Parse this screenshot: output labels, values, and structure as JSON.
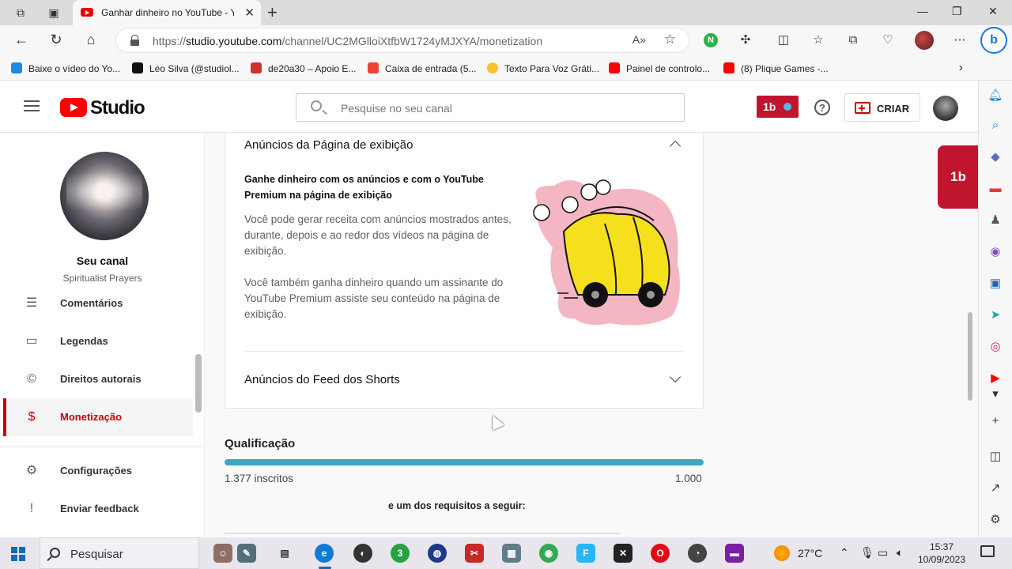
{
  "browser": {
    "tab_title": "Ganhar dinheiro no YouTube - Yo",
    "url_prefix": "https://",
    "url_host": "studio.youtube.com",
    "url_path": "/channel/UC2MGlloiXtfbW1724yMJXYA/monetization",
    "bookmarks": [
      {
        "label": "Baixe o vídeo do Yo...",
        "icon": "download-icon",
        "color": "#1e88e5"
      },
      {
        "label": "Léo Silva (@studiol...",
        "icon": "tiktok-icon",
        "color": "#111111"
      },
      {
        "label": "de20a30 – Apoio E...",
        "icon": "bus-icon",
        "color": "#d32f2f"
      },
      {
        "label": "Caixa de entrada (5...",
        "icon": "gmail-icon",
        "color": "#ea4335"
      },
      {
        "label": "Texto Para Voz Gráti...",
        "icon": "emoji-icon",
        "color": "#fbc02d"
      },
      {
        "label": "Painel de controlo...",
        "icon": "youtube-icon",
        "color": "#ff0000"
      },
      {
        "label": "(8) Plique Games -...",
        "icon": "youtube-icon",
        "color": "#ff0000"
      }
    ]
  },
  "studio": {
    "logo_text": "Studio",
    "search_placeholder": "Pesquise no seu canal",
    "tubebuddy_label": "1b",
    "create_label": "CRIAR"
  },
  "sidebar": {
    "channel_name": "Seu canal",
    "channel_sub": "Spiritualist Prayers",
    "items": [
      {
        "label": "Comentários",
        "icon": "comment-icon",
        "glyph": "☰"
      },
      {
        "label": "Legendas",
        "icon": "subtitles-icon",
        "glyph": "▭"
      },
      {
        "label": "Direitos autorais",
        "icon": "copyright-icon",
        "glyph": "©"
      },
      {
        "label": "Monetização",
        "icon": "dollar-icon",
        "glyph": "$"
      },
      {
        "label": "Configurações",
        "icon": "gear-icon",
        "glyph": "⚙"
      },
      {
        "label": "Enviar feedback",
        "icon": "feedback-icon",
        "glyph": "!"
      }
    ]
  },
  "monetization": {
    "watch_page_title": "Anúncios da Página de exibição",
    "watch_page_heading": "Ganhe dinheiro com os anúncios e com o YouTube Premium na página de exibição",
    "paragraph1": "Você pode gerar receita com anúncios mostrados antes, durante, depois e ao redor dos vídeos na página de exibição.",
    "paragraph2": "Você também ganha dinheiro quando um assinante do YouTube Premium assiste seu conteúdo na página de exibição.",
    "shorts_title": "Anúncios do Feed dos Shorts",
    "qualification_title": "Qualificação",
    "subscribers": "1.377 inscritos",
    "subscribers_goal": "1.000",
    "progress_fraction": 1.0,
    "requirements_text": "e um dos requisitos a seguir:",
    "accent_color": "#3ea6c0"
  },
  "taskbar": {
    "search_label": "Pesquisar",
    "temperature": "27°C",
    "time": "15:37",
    "date": "10/09/2023"
  }
}
